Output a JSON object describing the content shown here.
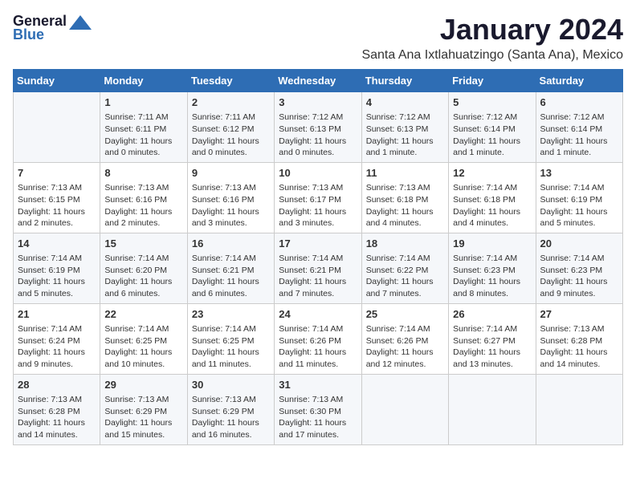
{
  "logo": {
    "general": "General",
    "blue": "Blue"
  },
  "title": "January 2024",
  "subtitle": "Santa Ana Ixtlahuatzingo (Santa Ana), Mexico",
  "days_of_week": [
    "Sunday",
    "Monday",
    "Tuesday",
    "Wednesday",
    "Thursday",
    "Friday",
    "Saturday"
  ],
  "weeks": [
    [
      {
        "day": "",
        "content": ""
      },
      {
        "day": "1",
        "content": "Sunrise: 7:11 AM\nSunset: 6:11 PM\nDaylight: 11 hours\nand 0 minutes."
      },
      {
        "day": "2",
        "content": "Sunrise: 7:11 AM\nSunset: 6:12 PM\nDaylight: 11 hours\nand 0 minutes."
      },
      {
        "day": "3",
        "content": "Sunrise: 7:12 AM\nSunset: 6:13 PM\nDaylight: 11 hours\nand 0 minutes."
      },
      {
        "day": "4",
        "content": "Sunrise: 7:12 AM\nSunset: 6:13 PM\nDaylight: 11 hours\nand 1 minute."
      },
      {
        "day": "5",
        "content": "Sunrise: 7:12 AM\nSunset: 6:14 PM\nDaylight: 11 hours\nand 1 minute."
      },
      {
        "day": "6",
        "content": "Sunrise: 7:12 AM\nSunset: 6:14 PM\nDaylight: 11 hours\nand 1 minute."
      }
    ],
    [
      {
        "day": "7",
        "content": "Sunrise: 7:13 AM\nSunset: 6:15 PM\nDaylight: 11 hours\nand 2 minutes."
      },
      {
        "day": "8",
        "content": "Sunrise: 7:13 AM\nSunset: 6:16 PM\nDaylight: 11 hours\nand 2 minutes."
      },
      {
        "day": "9",
        "content": "Sunrise: 7:13 AM\nSunset: 6:16 PM\nDaylight: 11 hours\nand 3 minutes."
      },
      {
        "day": "10",
        "content": "Sunrise: 7:13 AM\nSunset: 6:17 PM\nDaylight: 11 hours\nand 3 minutes."
      },
      {
        "day": "11",
        "content": "Sunrise: 7:13 AM\nSunset: 6:18 PM\nDaylight: 11 hours\nand 4 minutes."
      },
      {
        "day": "12",
        "content": "Sunrise: 7:14 AM\nSunset: 6:18 PM\nDaylight: 11 hours\nand 4 minutes."
      },
      {
        "day": "13",
        "content": "Sunrise: 7:14 AM\nSunset: 6:19 PM\nDaylight: 11 hours\nand 5 minutes."
      }
    ],
    [
      {
        "day": "14",
        "content": "Sunrise: 7:14 AM\nSunset: 6:19 PM\nDaylight: 11 hours\nand 5 minutes."
      },
      {
        "day": "15",
        "content": "Sunrise: 7:14 AM\nSunset: 6:20 PM\nDaylight: 11 hours\nand 6 minutes."
      },
      {
        "day": "16",
        "content": "Sunrise: 7:14 AM\nSunset: 6:21 PM\nDaylight: 11 hours\nand 6 minutes."
      },
      {
        "day": "17",
        "content": "Sunrise: 7:14 AM\nSunset: 6:21 PM\nDaylight: 11 hours\nand 7 minutes."
      },
      {
        "day": "18",
        "content": "Sunrise: 7:14 AM\nSunset: 6:22 PM\nDaylight: 11 hours\nand 7 minutes."
      },
      {
        "day": "19",
        "content": "Sunrise: 7:14 AM\nSunset: 6:23 PM\nDaylight: 11 hours\nand 8 minutes."
      },
      {
        "day": "20",
        "content": "Sunrise: 7:14 AM\nSunset: 6:23 PM\nDaylight: 11 hours\nand 9 minutes."
      }
    ],
    [
      {
        "day": "21",
        "content": "Sunrise: 7:14 AM\nSunset: 6:24 PM\nDaylight: 11 hours\nand 9 minutes."
      },
      {
        "day": "22",
        "content": "Sunrise: 7:14 AM\nSunset: 6:25 PM\nDaylight: 11 hours\nand 10 minutes."
      },
      {
        "day": "23",
        "content": "Sunrise: 7:14 AM\nSunset: 6:25 PM\nDaylight: 11 hours\nand 11 minutes."
      },
      {
        "day": "24",
        "content": "Sunrise: 7:14 AM\nSunset: 6:26 PM\nDaylight: 11 hours\nand 11 minutes."
      },
      {
        "day": "25",
        "content": "Sunrise: 7:14 AM\nSunset: 6:26 PM\nDaylight: 11 hours\nand 12 minutes."
      },
      {
        "day": "26",
        "content": "Sunrise: 7:14 AM\nSunset: 6:27 PM\nDaylight: 11 hours\nand 13 minutes."
      },
      {
        "day": "27",
        "content": "Sunrise: 7:13 AM\nSunset: 6:28 PM\nDaylight: 11 hours\nand 14 minutes."
      }
    ],
    [
      {
        "day": "28",
        "content": "Sunrise: 7:13 AM\nSunset: 6:28 PM\nDaylight: 11 hours\nand 14 minutes."
      },
      {
        "day": "29",
        "content": "Sunrise: 7:13 AM\nSunset: 6:29 PM\nDaylight: 11 hours\nand 15 minutes."
      },
      {
        "day": "30",
        "content": "Sunrise: 7:13 AM\nSunset: 6:29 PM\nDaylight: 11 hours\nand 16 minutes."
      },
      {
        "day": "31",
        "content": "Sunrise: 7:13 AM\nSunset: 6:30 PM\nDaylight: 11 hours\nand 17 minutes."
      },
      {
        "day": "",
        "content": ""
      },
      {
        "day": "",
        "content": ""
      },
      {
        "day": "",
        "content": ""
      }
    ]
  ]
}
